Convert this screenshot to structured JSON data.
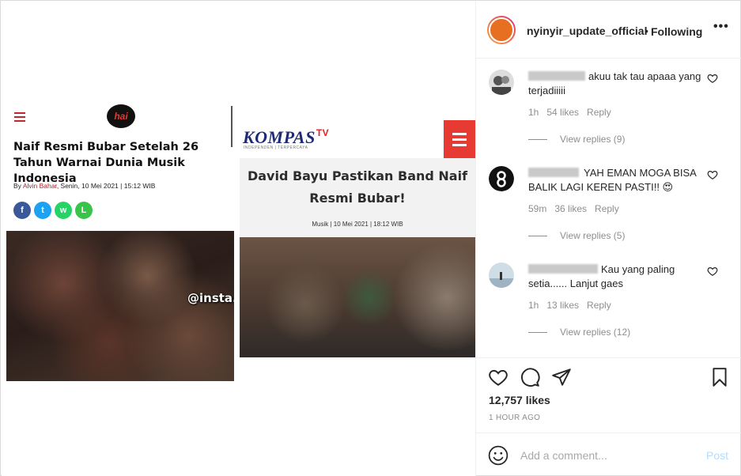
{
  "post": {
    "username": "nyinyir_update_official",
    "separator": "•",
    "follow_status": "Following",
    "more_label": "•••"
  },
  "media": {
    "left_article": {
      "logo_text": "hai",
      "headline": "Naif Resmi Bubar Setelah 26 Tahun Warnai Dunia Musik Indonesia",
      "byline_prefix": "By ",
      "author": "Alvin Bahar",
      "byline_suffix": ", Senin, 10 Mei 2021 | 15:12 WIB",
      "share_icons": [
        "facebook-icon",
        "twitter-icon",
        "whatsapp-icon",
        "line-icon"
      ],
      "share_glyphs": [
        "f",
        "t",
        "w",
        "L"
      ],
      "watermark": "@insta.nyinyir"
    },
    "right_article": {
      "brand": "KOMPAS",
      "brand_suffix": "TV",
      "tagline": "INDEPENDEN | TERPERCAYA",
      "headline": "David Bayu Pastikan Band Naif Resmi Bubar!",
      "meta": "Musik | 10 Mei 2021 | 18:12 WIB"
    }
  },
  "comments": [
    {
      "text": "akuu tak tau apaaa yang terjadiiiii",
      "time": "1h",
      "likes": "54 likes",
      "reply_label": "Reply",
      "view_replies": "View replies (9)"
    },
    {
      "text": "YAH EMAN MOGA BISA BALIK LAGI KEREN PASTI!! 😍",
      "time": "59m",
      "likes": "36 likes",
      "reply_label": "Reply",
      "view_replies": "View replies (5)"
    },
    {
      "text": "Kau yang paling setia...... Lanjut gaes",
      "time": "1h",
      "likes": "13 likes",
      "reply_label": "Reply",
      "view_replies": "View replies (12)"
    }
  ],
  "actions": {
    "likes_count": "12,757 likes",
    "posted_time": "1 HOUR AGO"
  },
  "add_comment": {
    "placeholder": "Add a comment...",
    "post_label": "Post"
  },
  "colors": {
    "text": "#262626",
    "muted": "#8e8e8e",
    "border": "#efefef",
    "post_disabled": "#b3dbff",
    "kompas_red": "#e63a33",
    "hai_red": "#c0272d"
  }
}
